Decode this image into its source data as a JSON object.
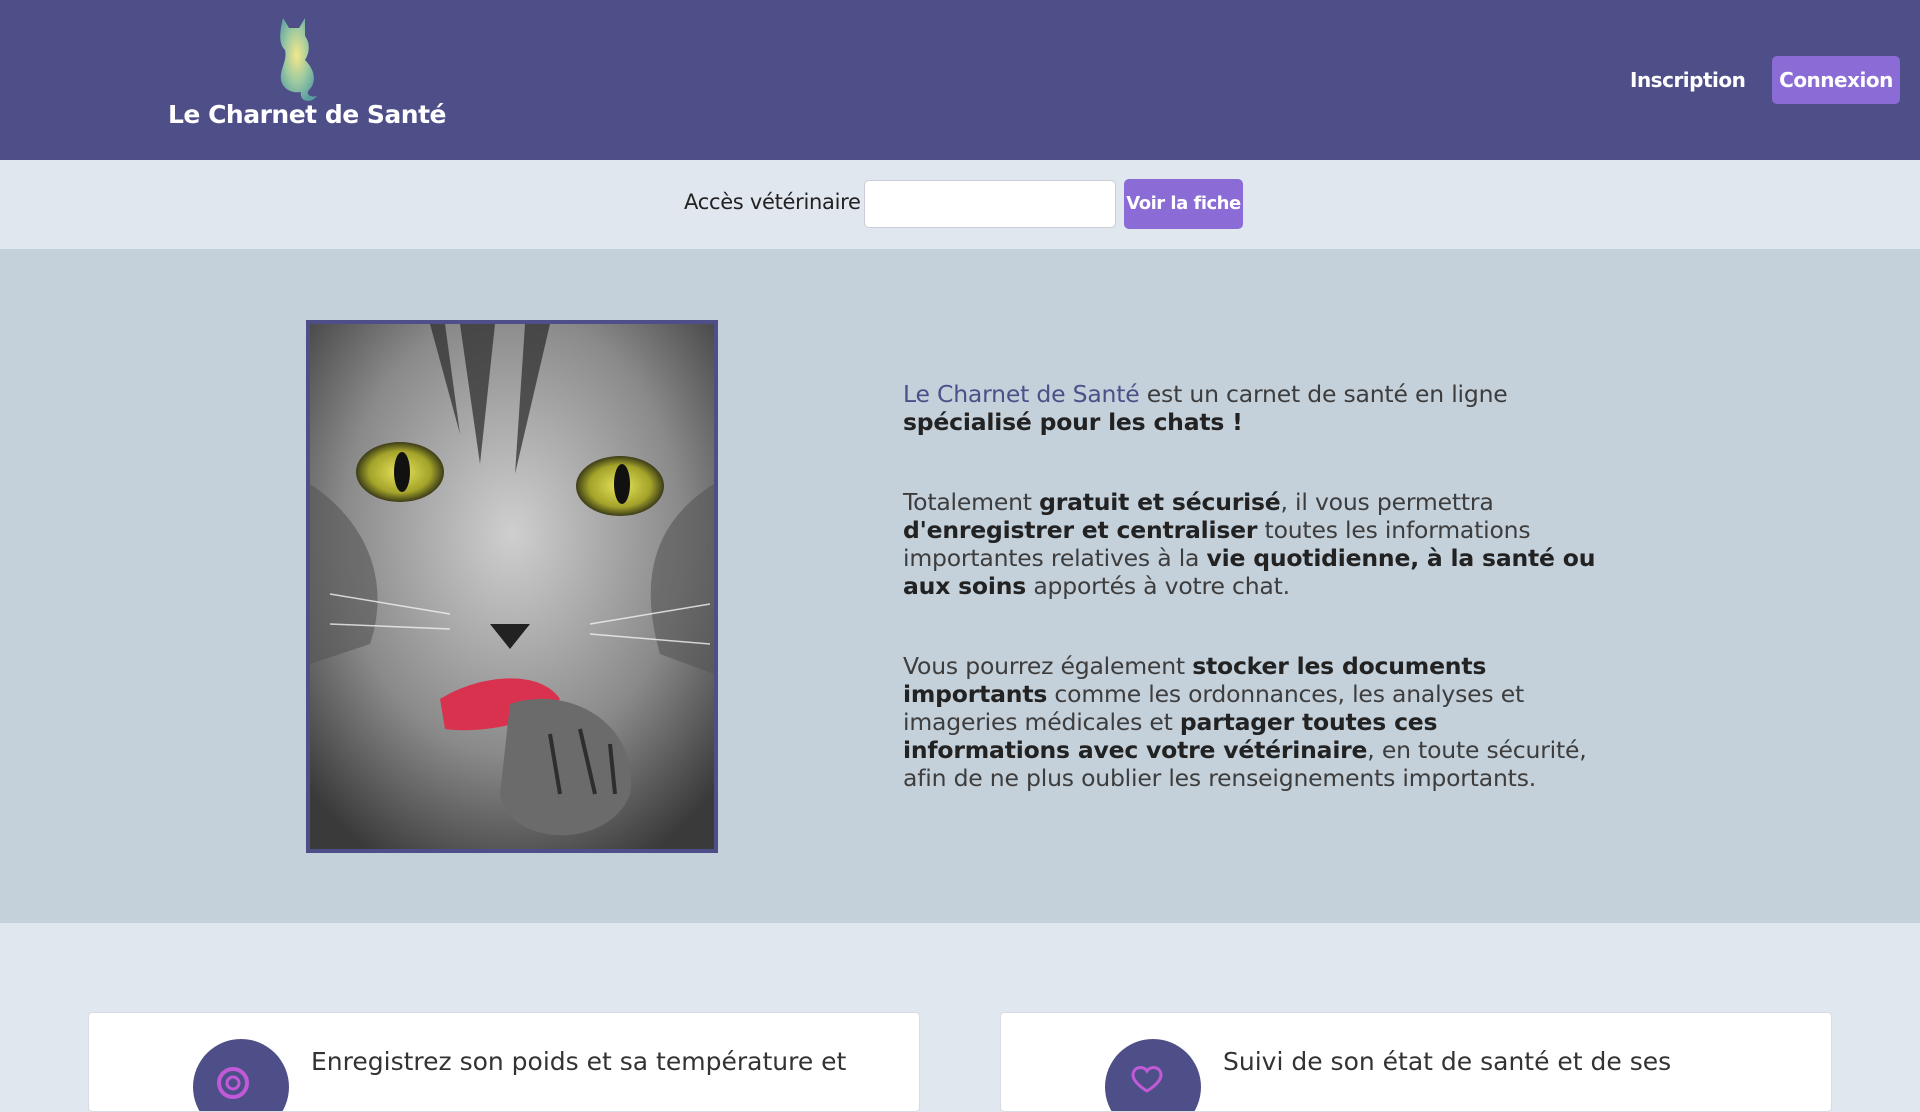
{
  "header": {
    "brand": "Le Charnet de Santé",
    "logo_icon": "cat-silhouette-icon",
    "nav": {
      "inscription": "Inscription",
      "connexion": "Connexion"
    },
    "colors": {
      "bar": "#4e4f89",
      "accent": "#8b6bd6"
    }
  },
  "vet_access": {
    "label": "Accès vétérinaire :",
    "input_value": "",
    "button": "Voir la fiche"
  },
  "hero": {
    "image": "cat-licking-paw-photo",
    "p1": {
      "brand": "Le Charnet de Santé",
      "t1": " est un carnet de santé en ligne ",
      "b1": "spécialisé pour les chats !"
    },
    "p2": {
      "t1": "Totalement ",
      "b1": "gratuit et sécurisé",
      "t2": ", il vous permettra ",
      "b2": "d'enregistrer et centraliser",
      "t3": " toutes les informations importantes relatives à la ",
      "b3": "vie quotidienne, à la santé ou aux soins",
      "t4": " apportés à votre chat."
    },
    "p3": {
      "t1": "Vous pourrez également ",
      "b1": "stocker les documents importants",
      "t2": " comme les ordonnances, les analyses et imageries médicales et ",
      "b2": "partager toutes ces informations avec votre vétérinaire",
      "t3": ", en toute sécurité, afin de ne plus oublier les renseignements importants."
    }
  },
  "features": [
    {
      "icon": "scale-icon",
      "text": "Enregistrez son poids et sa température et"
    },
    {
      "icon": "heart-icon",
      "text": "Suivi de son état de santé et de ses"
    }
  ]
}
